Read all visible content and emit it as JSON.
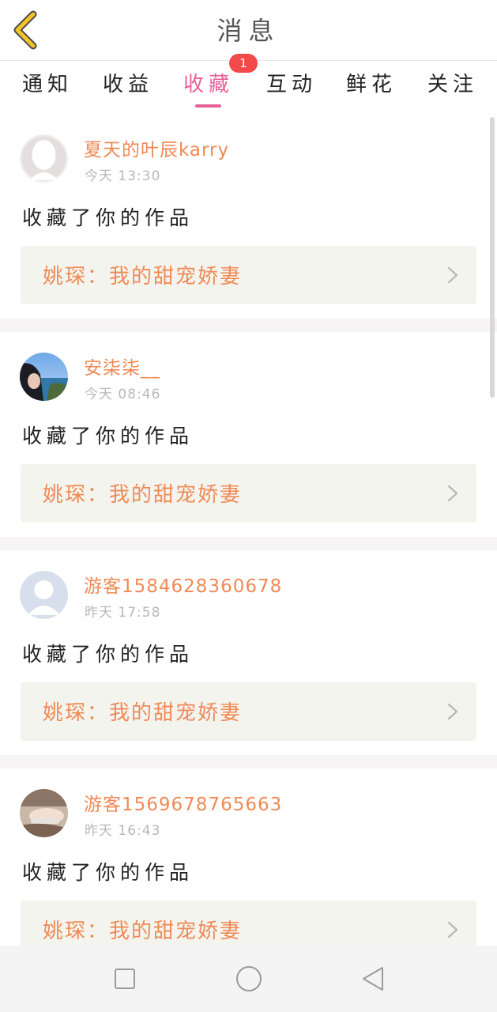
{
  "header": {
    "title": "消息",
    "back_icon": "chevron-left-icon",
    "accent_color": "#f2c428"
  },
  "tabs": {
    "items": [
      {
        "label": "通知"
      },
      {
        "label": "收益"
      },
      {
        "label": "收藏",
        "active": true,
        "badge": "1"
      },
      {
        "label": "互动"
      },
      {
        "label": "鲜花"
      },
      {
        "label": "关注"
      }
    ],
    "active_color": "#e8609a",
    "badge_color": "#f24a4a"
  },
  "messages": [
    {
      "username": "夏天的叶辰karry",
      "time": "今天 13:30",
      "action": "收藏了你的作品",
      "work_title": "姚琛：我的甜宠娇妻",
      "avatar": "default-avatar-white"
    },
    {
      "username": "安柒柒__",
      "time": "今天 08:46",
      "action": "收藏了你的作品",
      "work_title": "姚琛：我的甜宠娇妻",
      "avatar": "photo-avatar-seaside"
    },
    {
      "username": "游客1584628360678",
      "time": "昨天 17:58",
      "action": "收藏了你的作品",
      "work_title": "姚琛：我的甜宠娇妻",
      "avatar": "default-avatar-grey"
    },
    {
      "username": "游客1569678765663",
      "time": "昨天 16:43",
      "action": "收藏了你的作品",
      "work_title": "姚琛：我的甜宠娇妻",
      "avatar": "photo-avatar-hands"
    }
  ],
  "colors": {
    "username": "#ef8a56",
    "work_card_bg": "#f4f4ee"
  },
  "navbar": {
    "buttons": [
      "square-icon",
      "circle-icon",
      "triangle-back-icon"
    ]
  }
}
